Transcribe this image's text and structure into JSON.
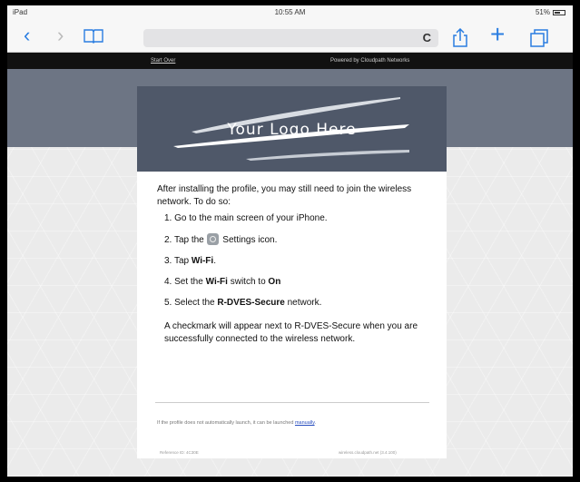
{
  "status_bar": {
    "carrier": "iPad",
    "time": "10:55 AM",
    "battery": "51%"
  },
  "browser": {
    "back_icon": "chevron-left-icon",
    "forward_icon": "chevron-right-icon",
    "reload": "C"
  },
  "header": {
    "start_over": "Start Over",
    "powered_by": "Powered by Cloudpath Networks"
  },
  "logo": {
    "text": "Your Logo Here"
  },
  "content": {
    "intro": "After installing the profile, you may still need to join the wireless network. To do so:",
    "step1": "1. Go to the main screen of your iPhone.",
    "step2_pre": "2. Tap the ",
    "step2_post": " Settings icon.",
    "step3_pre": "3. Tap ",
    "step3_bold": "Wi-Fi",
    "step3_post": ".",
    "step4_pre": "4. Set the ",
    "step4_bold": "Wi-Fi",
    "step4_mid": " switch to ",
    "step4_bold2": "On",
    "step5_pre": "5. Select the ",
    "step5_bold": "R-DVES-Secure",
    "step5_post": " network.",
    "note": "A checkmark will appear next to R-DVES-Secure when you are successfully connected to the wireless network."
  },
  "footer": {
    "text": "If the profile does not automatically launch, it can be launched ",
    "link": "manually",
    "link_end": ".",
    "bottom_left": "Reference ID: 4C30E",
    "bottom_right": "wireless.cloudpath.net (3.4.100)"
  }
}
